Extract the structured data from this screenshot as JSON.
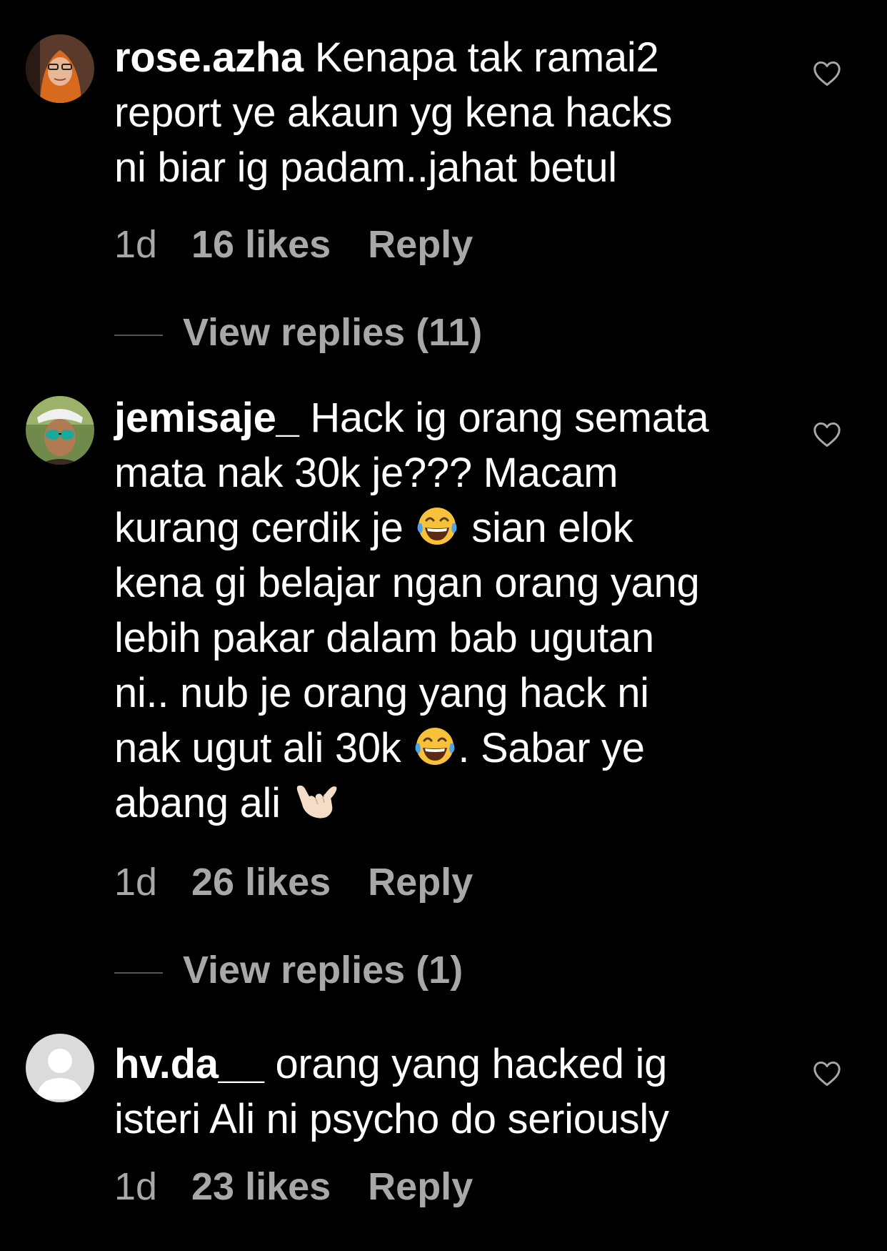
{
  "colors": {
    "background": "#000000",
    "text": "#ffffff",
    "secondary": "#a8a8a8"
  },
  "comments": [
    {
      "username": "rose.azha",
      "text_parts": [
        "Kenapa tak ramai2\nreport ye akaun yg kena hacks\nni biar ig padam..jahat betul"
      ],
      "time": "1d",
      "likes": "16 likes",
      "reply": "Reply",
      "view_replies": "View replies (11)",
      "avatar_icon": "user-photo-icon"
    },
    {
      "username": "jemisaje_",
      "text_parts": [
        "Hack ig orang semata\nmata nak 30k je??? Macam\nkurang cerdik je ",
        " sian elok\nkena gi belajar ngan orang yang\nlebih pakar dalam bab ugutan\nni.. nub je orang yang hack ni\nnak ugut ali 30k ",
        ". Sabar ye\nabang ali "
      ],
      "emojis": [
        "tears-of-joy-emoji",
        "tears-of-joy-emoji",
        "call-me-hand-emoji"
      ],
      "time": "1d",
      "likes": "26 likes",
      "reply": "Reply",
      "view_replies": "View replies (1)",
      "avatar_icon": "user-photo-icon"
    },
    {
      "username": "hv.da__",
      "text_parts": [
        "orang yang hacked ig\nisteri Ali ni psycho do seriously"
      ],
      "time": "1d",
      "likes": "23 likes",
      "reply": "Reply",
      "avatar_icon": "default-avatar-icon"
    }
  ]
}
